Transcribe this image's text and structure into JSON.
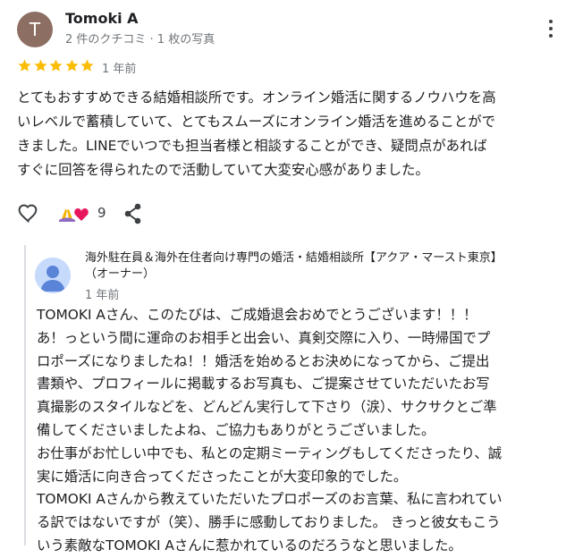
{
  "reviewer": {
    "initial": "T",
    "name": "Tomoki A",
    "meta": "2 件のクチコミ · 1 枚の写真",
    "avatar_color": "#8d6e63"
  },
  "rating": {
    "stars": 5,
    "date": "1 年前",
    "star_color": "#fbbc04"
  },
  "review": {
    "lines": [
      "とてもおすすめできる結婚相談所です。オンライン婚活に関するノウハウを高",
      "いレベルで蓄積していて、とてもスムーズにオンライン婚活を進めることがで",
      "きました。LINEでいつでも担当者様と相談することができ、疑問点があれば",
      "すぐに回答を得られたので活動していて大変安心感がありました。"
    ]
  },
  "actions": {
    "like_icon": "heart-outline-icon",
    "reactions": [
      "pray-emoji",
      "heart-emoji"
    ],
    "reaction_count": "9",
    "share_icon": "share-icon"
  },
  "owner_reply": {
    "name": "海外駐在員＆海外在住者向け専門の婚活・結婚相談所【アクア・マースト東京】",
    "role": "（オーナー）",
    "date": "1 年前",
    "lines": [
      "TOMOKI Aさん、このたびは、ご成婚退会おめでとうございます！！！",
      "あ！っという間に運命のお相手と出会い、真剣交際に入り、一時帰国でプ",
      "ロポーズになりましたね！！婚活を始めるとお決めになってから、ご提出",
      "書類や、プロフィールに掲載するお写真も、ご提案させていただいたお写",
      "真撮影のスタイルなどを、どんどん実行して下さり（涙）、サクサクとご準",
      "備してくださいましたよね、ご協力もありがとうございました。",
      "お仕事がお忙しい中でも、私との定期ミーティングもしてくださったり、誠",
      "実に婚活に向き合ってくださったことが大変印象的でした。",
      "TOMOKI Aさんから教えていただいたプロポーズのお言葉、私に言われてい",
      "る訳ではないですが（笑）、勝手に感動しておりました。 きっと彼女もこう",
      "いう素敵なTOMOKI Aさんに惹かれているのだろうなと思いました。"
    ]
  }
}
